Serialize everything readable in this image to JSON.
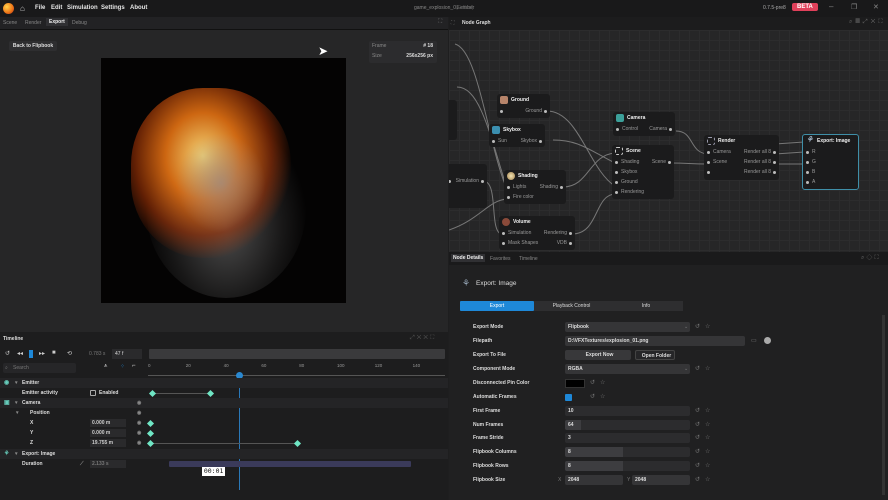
{
  "app": {
    "menu": [
      "File",
      "Edit",
      "Simulation",
      "Settings",
      "About"
    ],
    "title": "game_explosion_01.ember",
    "title_suffix": "(Edited)",
    "version": "0.7.5-pre8",
    "badge": "BETA",
    "badge_color": "#e0405a"
  },
  "left_tabs": [
    "Scene",
    "Render",
    "Export",
    "Debug"
  ],
  "viewport": {
    "back_button": "Back to Flipbook",
    "info": [
      {
        "label": "Frame",
        "value": "# 18"
      },
      {
        "label": "Size",
        "value": "256x256 px"
      }
    ]
  },
  "graph": {
    "title": "Node Graph",
    "nodes": {
      "ground": {
        "title": "Ground",
        "out": "Ground"
      },
      "skybox": {
        "title": "Skybox",
        "in": "Sun",
        "out": "Skybox"
      },
      "camera": {
        "title": "Camera",
        "in": "Control",
        "out": "Camera"
      },
      "scene": {
        "title": "Scene",
        "inputs": [
          "Shading",
          "Skybox",
          "Ground",
          "Rendering"
        ],
        "out": "Scene"
      },
      "shading": {
        "title": "Shading",
        "inputs": [
          "Lights",
          "Fire color"
        ],
        "out": "Shading"
      },
      "volume": {
        "title": "Volume",
        "inputs": [
          "Simulation",
          "Mask Shapes"
        ],
        "outputs": [
          "Rendering",
          "VDB"
        ]
      },
      "render": {
        "title": "Render",
        "inputs": [
          "Camera",
          "Scene"
        ],
        "outputs": [
          "Render all 8",
          "Render all 8",
          "Render all 8"
        ]
      },
      "export": {
        "title": "Export: Image",
        "inputs": [
          "R",
          "G",
          "B",
          "A"
        ]
      },
      "partial": {
        "out": "Simulation"
      }
    }
  },
  "details": {
    "tabs": [
      "Node Details",
      "Favorites",
      "Timeline"
    ],
    "node_title": "Export: Image",
    "sub_tabs": [
      "Export",
      "Playback Control",
      "Info"
    ],
    "accent": "#1e88d8",
    "props": [
      {
        "label": "Export Mode",
        "value": "Flipbook",
        "type": "select"
      },
      {
        "label": "Filepath",
        "value": "D:\\VFXTextures\\explosion_01.png",
        "type": "path"
      },
      {
        "label": "Export To File",
        "buttons": [
          "Export Now",
          "Open Folder"
        ],
        "type": "buttons"
      },
      {
        "label": "Component Mode",
        "value": "RGBA",
        "type": "select"
      },
      {
        "label": "Disconnected Pin Color",
        "value": "#000000",
        "type": "color"
      },
      {
        "label": "Automatic Frames",
        "checked": true,
        "type": "check"
      },
      {
        "label": "First Frame",
        "value": "10",
        "type": "num",
        "fill": 0
      },
      {
        "label": "Num Frames",
        "value": "64",
        "type": "num",
        "fill": 0.13
      },
      {
        "label": "Frame Stride",
        "value": "3",
        "type": "num",
        "fill": 0
      },
      {
        "label": "Flipbook Columns",
        "value": "8",
        "type": "num",
        "fill": 0.46
      },
      {
        "label": "Flipbook Rows",
        "value": "8",
        "type": "num",
        "fill": 0.46
      },
      {
        "label": "Flipbook Size",
        "x": "2048",
        "y": "2048",
        "type": "xy"
      }
    ]
  },
  "timeline": {
    "title": "Timeline",
    "time": "0.783 s",
    "frame": "47 f",
    "search_placeholder": "Search",
    "ticks": [
      "0",
      "20",
      "40",
      "60",
      "80",
      "100",
      "120",
      "140"
    ],
    "current_frame": 47,
    "tooltip": "00:01",
    "tracks": [
      {
        "label": "Emitter",
        "level": 0,
        "icon": "emitter-icon"
      },
      {
        "label": "Emitter activity",
        "level": 1,
        "check_label": "Enabled",
        "keys": [
          1,
          32
        ]
      },
      {
        "label": "Camera",
        "level": 0,
        "icon": "camera-icon"
      },
      {
        "label": "Position",
        "level": 1
      },
      {
        "label": "X",
        "level": 2,
        "value": "0.000 m",
        "keys": [
          0
        ]
      },
      {
        "label": "Y",
        "level": 2,
        "value": "0.000 m",
        "keys": [
          0
        ]
      },
      {
        "label": "Z",
        "level": 2,
        "value": "19.755 m",
        "keys": [
          0,
          78
        ]
      },
      {
        "label": "Export: Image",
        "level": 0,
        "icon": "export-icon"
      },
      {
        "label": "Duration",
        "level": 1,
        "value": "2.133 s",
        "range": [
          10,
          138
        ]
      }
    ]
  }
}
